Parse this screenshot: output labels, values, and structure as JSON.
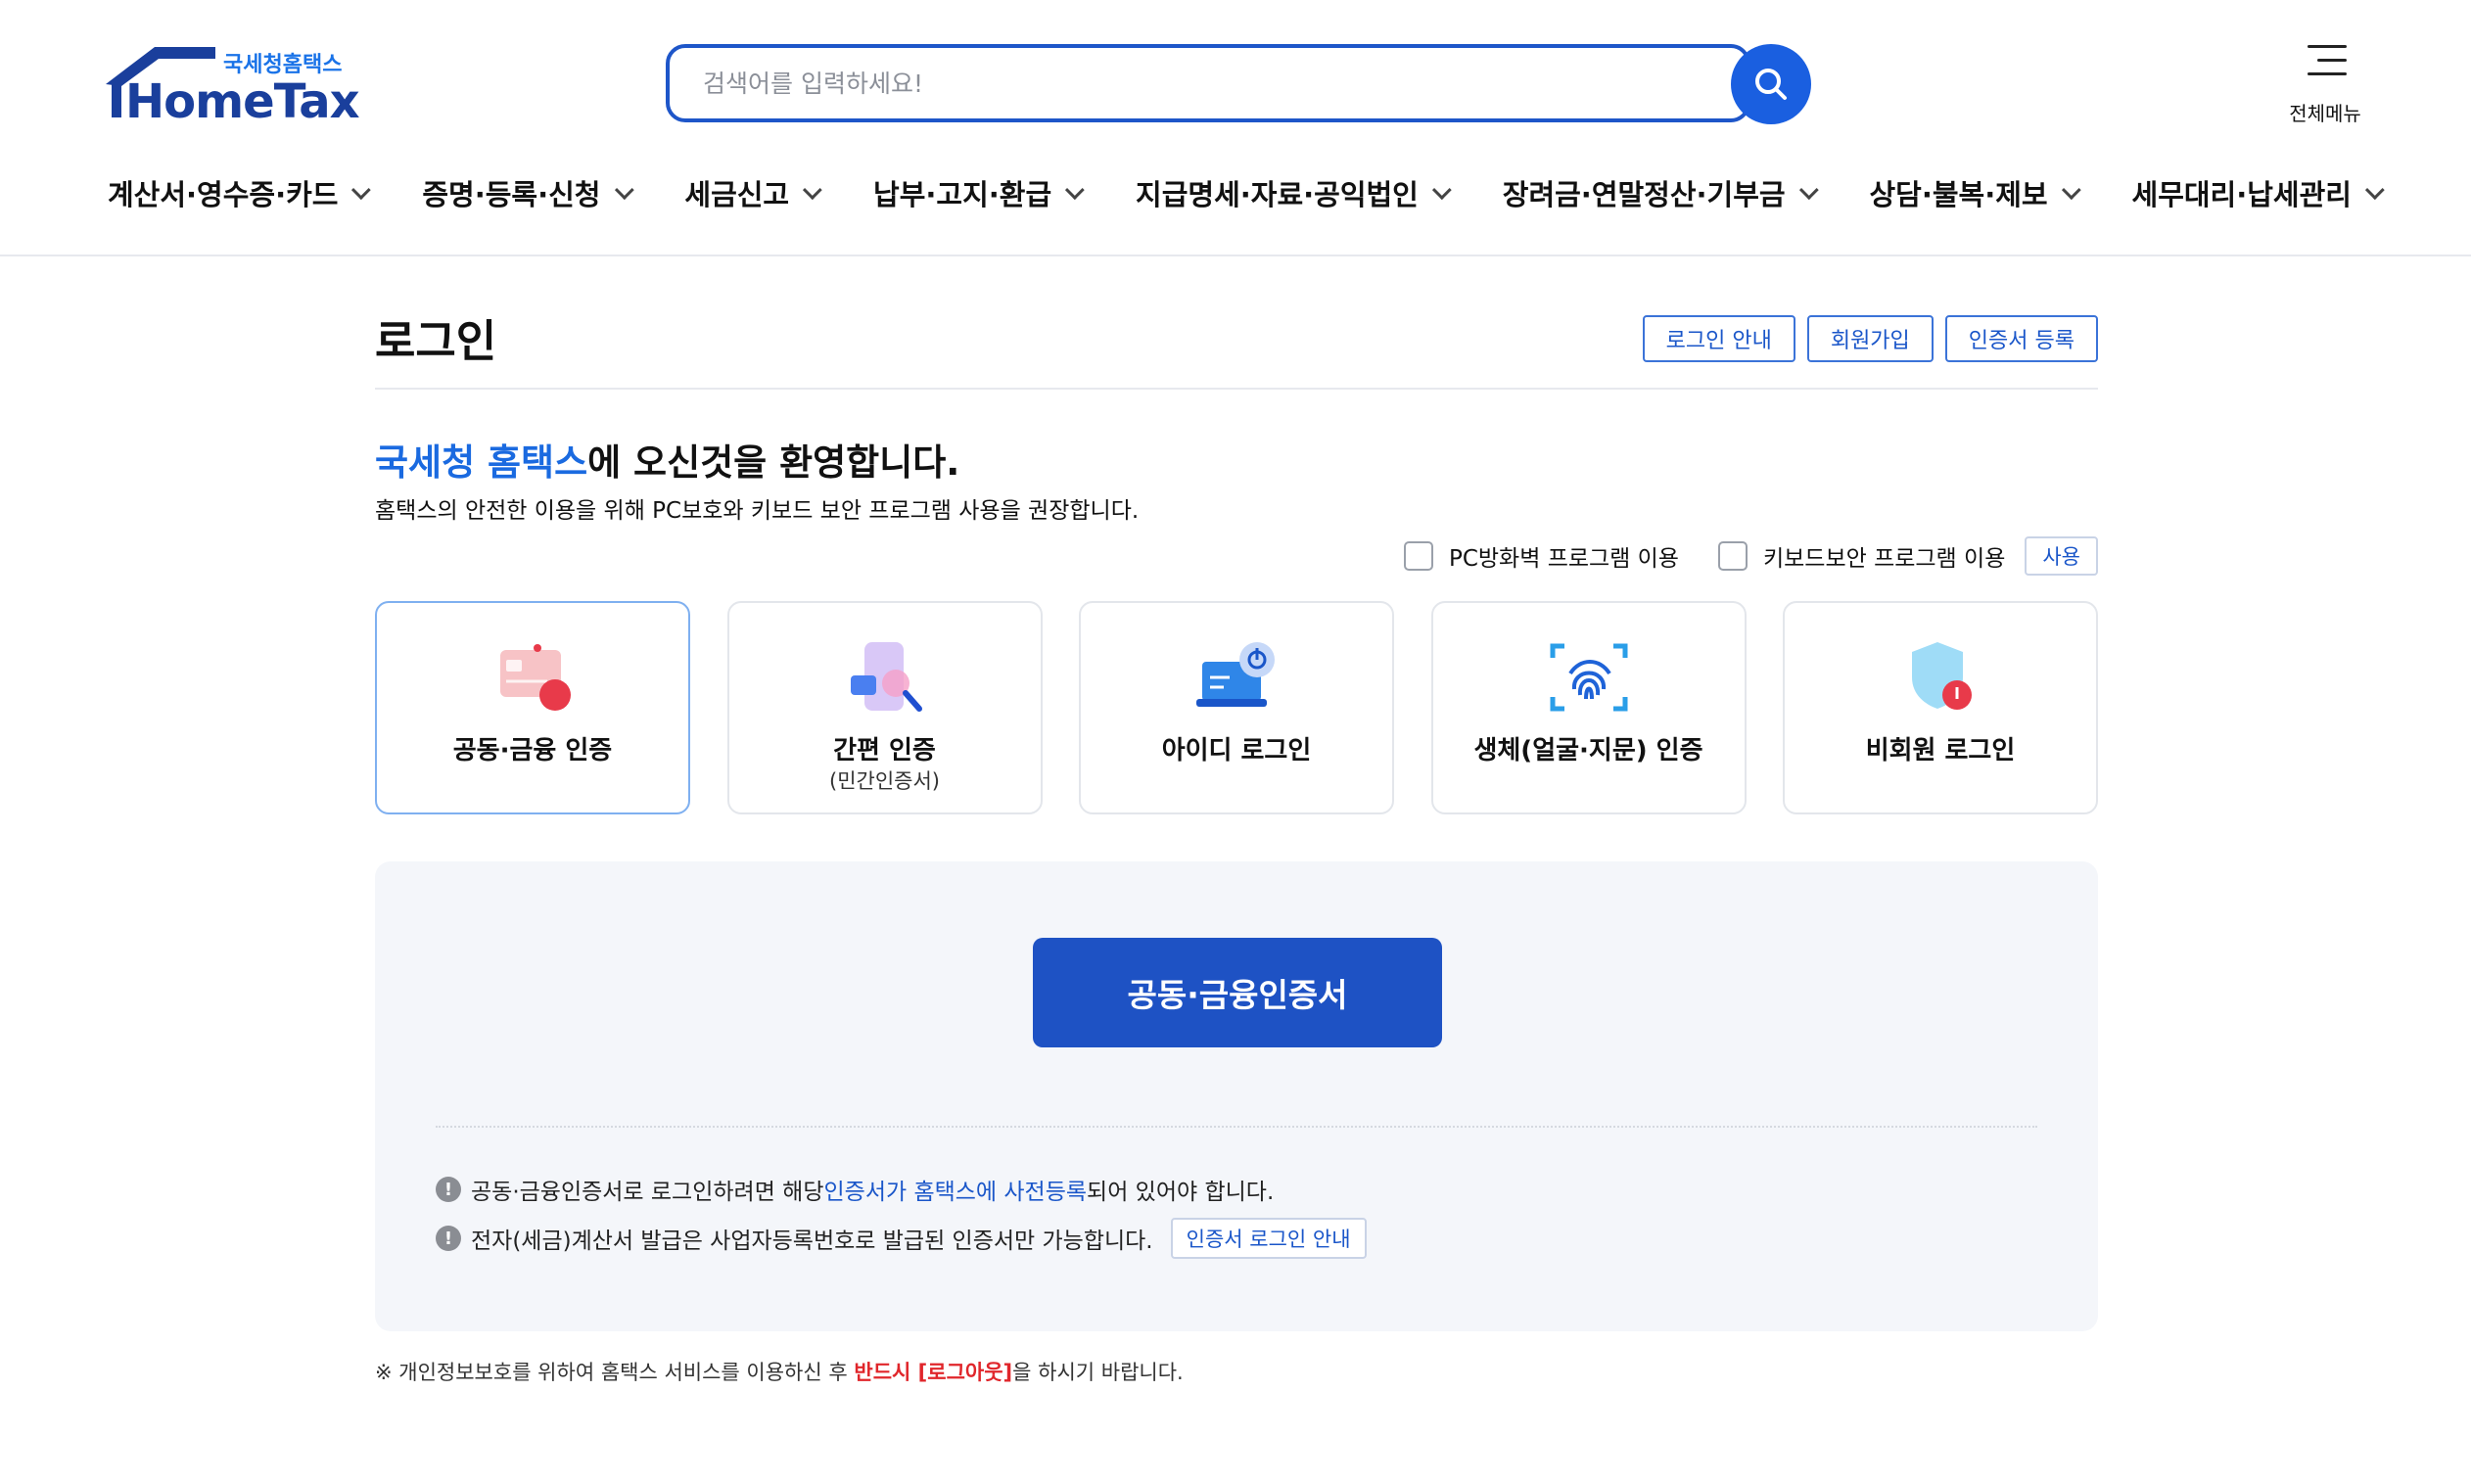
{
  "header": {
    "logo_sub": "국세청홈택스",
    "logo_main": "HomeTax",
    "search_placeholder": "검색어를 입력하세요!",
    "allmenu_label": "전체메뉴",
    "nav": [
      "계산서·영수증·카드",
      "증명·등록·신청",
      "세금신고",
      "납부·고지·환급",
      "지급명세·자료·공익법인",
      "장려금·연말정산·기부금",
      "상담·불복·제보",
      "세무대리·납세관리"
    ]
  },
  "main": {
    "title": "로그인",
    "top_buttons": [
      "로그인 안내",
      "회원가입",
      "인증서 등록"
    ],
    "welcome_highlight": "국세청 홈택스",
    "welcome_rest": "에 오신것을 환영합니다.",
    "welcome_sub": "홈택스의 안전한 이용을 위해 PC보호와 키보드 보안 프로그램 사용을 권장합니다.",
    "option_firewall": "PC방화벽 프로그램 이용",
    "option_keyboard": "키보드보안 프로그램 이용",
    "use_button": "사용",
    "cards": [
      {
        "label": "공동·금융 인증",
        "sub": ""
      },
      {
        "label": "간편 인증",
        "sub": "(민간인증서)"
      },
      {
        "label": "아이디 로그인",
        "sub": ""
      },
      {
        "label": "생체(얼굴·지문) 인증",
        "sub": ""
      },
      {
        "label": "비회원 로그인",
        "sub": ""
      }
    ],
    "cert_button": "공동·금융인증서",
    "note1_pre": "공동·금융인증서로 로그인하려면 해당 ",
    "note1_link": "인증서가 홈택스에 사전등록",
    "note1_post": "되어 있어야 합니다.",
    "note2": "전자(세금)계산서 발급은 사업자등록번호로 발급된 인증서만 가능합니다.",
    "note2_button": "인증서 로그인 안내",
    "footer_pre": "※ 개인정보보호를 위하여 홈택스 서비스를 이용하신 후 ",
    "footer_red": "반드시 [로그아웃]",
    "footer_post": "을 하시기 바랍니다."
  },
  "colors": {
    "brand_blue": "#1e52c4",
    "link_blue": "#1a6ae0",
    "warning_red": "#e0262b"
  }
}
